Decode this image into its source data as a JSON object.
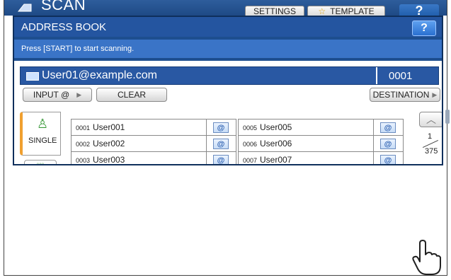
{
  "background_screen": {
    "title": "SCAN",
    "settings_label": "SETTINGS",
    "template_label": "TEMPLATE",
    "help_label": "?"
  },
  "dialog": {
    "title": "ADDRESS BOOK",
    "help_label": "?",
    "message": "Press [START] to start scanning."
  },
  "destination": {
    "email": "User01@example.com",
    "count": "0001"
  },
  "buttons": {
    "input_label": "INPUT @",
    "clear_label": "CLEAR",
    "destination_label": "DESTINATION"
  },
  "tabs": {
    "single_label": "SINGLE",
    "group_label": "◦◦◦"
  },
  "entries": [
    {
      "num": "0001",
      "name": "User001"
    },
    {
      "num": "0002",
      "name": "User002"
    },
    {
      "num": "0003",
      "name": "User003"
    },
    {
      "num": "0005",
      "name": "User005"
    },
    {
      "num": "0006",
      "name": "User006"
    },
    {
      "num": "0007",
      "name": "User007"
    }
  ],
  "email_icon_label": "@",
  "pagination": {
    "current": "1",
    "total": "375"
  }
}
